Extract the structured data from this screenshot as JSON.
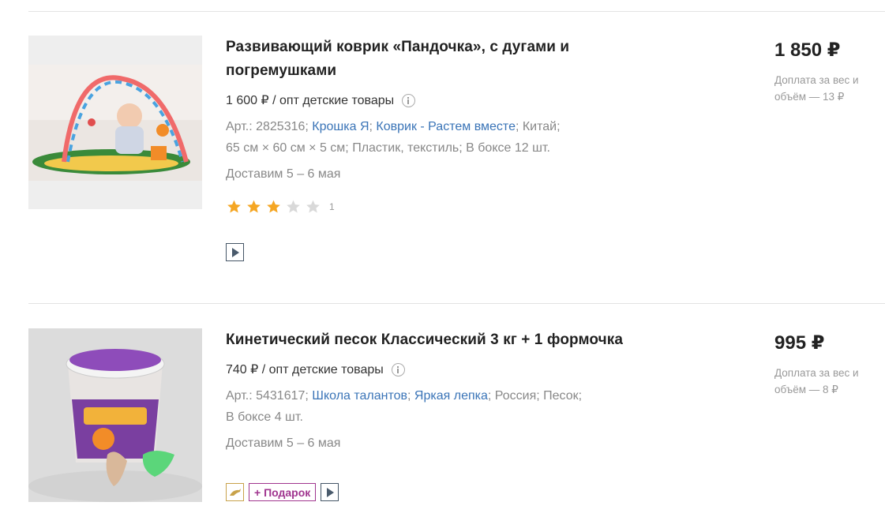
{
  "products": [
    {
      "title": "Развивающий коврик «Пандочка», с дугами и погремушками",
      "opt_price": "1 600 ₽ / опт детские товары",
      "art": "Арт.: 2825316;",
      "brand": "Крошка Я",
      "series": "Коврик - Растем вместе",
      "meta_rest": "; Китай;",
      "meta_line2": "65 см × 60 см × 5 см; Пластик, текстиль; В боксе 12 шт.",
      "delivery": "Доставим 5 – 6 мая",
      "rating": 3,
      "rating_max": 5,
      "rating_count": "1",
      "price": "1 850 ₽",
      "extra_fee": "Доплата за вес и объём — 13 ₽"
    },
    {
      "title": "Кинетический песок Классический 3 кг + 1 формочка",
      "opt_price": "740 ₽ / опт детские товары",
      "art": "Арт.: 5431617;",
      "brand": "Школа талантов",
      "series": "Яркая лепка",
      "meta_rest": "; Россия; Песок;",
      "meta_line2": "В боксе 4 шт.",
      "delivery": "Доставим 5 – 6 мая",
      "gift_label": "+ Подарок",
      "price": "995 ₽",
      "extra_fee": "Доплата за вес и объём — 8 ₽"
    }
  ],
  "colors": {
    "link": "#3a74b7",
    "star_on": "#f5a623",
    "star_off": "#d9d9d9",
    "gift": "#a0358f"
  },
  "icons": [
    "info-icon",
    "star-icon",
    "video-icon",
    "dolphin-icon"
  ]
}
